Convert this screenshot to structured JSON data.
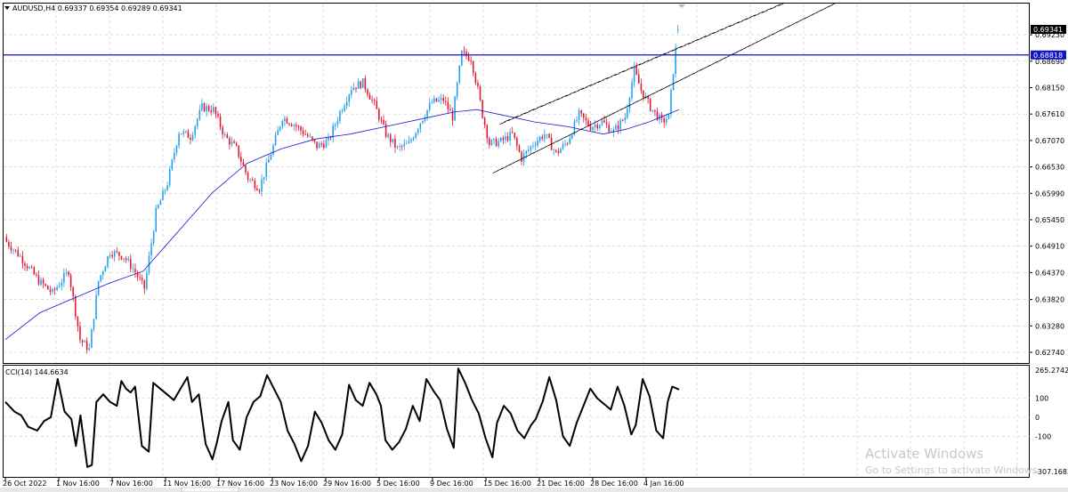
{
  "header": {
    "symbol_line": "AUDUSD,H4  0.69337 0.69354 0.69289 0.69341",
    "indicator_line": "CCI(14) 144.6634"
  },
  "colors": {
    "bull": "#1e9ff0",
    "bear": "#e8132a",
    "ma": "#1b1bd0",
    "hline": "#1212c8",
    "price_tag_bg": "#000000",
    "level_tag_bg": "#1212c8",
    "grid": "#c8c8c8",
    "cci_line": "#000000"
  },
  "watermark": {
    "title": "Activate Windows",
    "subtitle": "Go to Settings to activate Windows."
  },
  "chart_data": [
    {
      "type": "candlestick",
      "symbol": "AUDUSD",
      "timeframe": "H4",
      "last_bar": {
        "open": 0.69337,
        "high": 0.69354,
        "low": 0.69289,
        "close": 0.69341
      },
      "current_price_tag": "0.69341",
      "horizontal_level": {
        "value": 0.68818,
        "label": "0.68818"
      },
      "ylim": [
        0.6254,
        0.6985
      ],
      "yticks": [
        {
          "v": 0.6923,
          "label": "0.69230"
        },
        {
          "v": 0.6869,
          "label": "0.68690"
        },
        {
          "v": 0.6815,
          "label": "0.68150"
        },
        {
          "v": 0.6761,
          "label": "0.67610"
        },
        {
          "v": 0.6707,
          "label": "0.67070"
        },
        {
          "v": 0.6653,
          "label": "0.66530"
        },
        {
          "v": 0.6599,
          "label": "0.65990"
        },
        {
          "v": 0.6545,
          "label": "0.65450"
        },
        {
          "v": 0.6491,
          "label": "0.64910"
        },
        {
          "v": 0.6437,
          "label": "0.64370"
        },
        {
          "v": 0.6382,
          "label": "0.63820"
        },
        {
          "v": 0.6328,
          "label": "0.63280"
        },
        {
          "v": 0.6274,
          "label": "0.62740"
        }
      ],
      "xlabels": [
        "26 Oct 2022",
        "1 Nov 16:00",
        "7 Nov 16:00",
        "11 Nov 16:00",
        "17 Nov 16:00",
        "23 Nov 16:00",
        "29 Nov 16:00",
        "5 Dec 16:00",
        "9 Dec 16:00",
        "15 Dec 16:00",
        "21 Dec 16:00",
        "28 Dec 16:00",
        "4 Jan 16:00"
      ],
      "close_path": [
        [
          0,
          0.6505
        ],
        [
          7,
          0.647
        ],
        [
          15,
          0.642
        ],
        [
          21,
          0.6395
        ],
        [
          28,
          0.644
        ],
        [
          33,
          0.63
        ],
        [
          37,
          0.628
        ],
        [
          41,
          0.642
        ],
        [
          46,
          0.648
        ],
        [
          52,
          0.647
        ],
        [
          56,
          0.6445
        ],
        [
          61,
          0.6405
        ],
        [
          66,
          0.656
        ],
        [
          71,
          0.662
        ],
        [
          76,
          0.6725
        ],
        [
          81,
          0.6715
        ],
        [
          86,
          0.6775
        ],
        [
          91,
          0.677
        ],
        [
          96,
          0.6715
        ],
        [
          101,
          0.669
        ],
        [
          106,
          0.663
        ],
        [
          111,
          0.661
        ],
        [
          117,
          0.6695
        ],
        [
          121,
          0.6755
        ],
        [
          126,
          0.674
        ],
        [
          131,
          0.672
        ],
        [
          136,
          0.6695
        ],
        [
          141,
          0.6705
        ],
        [
          146,
          0.6765
        ],
        [
          151,
          0.6815
        ],
        [
          156,
          0.6825
        ],
        [
          161,
          0.678
        ],
        [
          166,
          0.672
        ],
        [
          171,
          0.669
        ],
        [
          176,
          0.67
        ],
        [
          181,
          0.6745
        ],
        [
          186,
          0.6785
        ],
        [
          191,
          0.679
        ],
        [
          195,
          0.6755
        ],
        [
          199,
          0.6885
        ],
        [
          203,
          0.6875
        ],
        [
          206,
          0.681
        ],
        [
          208,
          0.676
        ],
        [
          211,
          0.67
        ],
        [
          216,
          0.6705
        ],
        [
          221,
          0.672
        ],
        [
          225,
          0.667
        ],
        [
          230,
          0.67
        ],
        [
          235,
          0.672
        ],
        [
          240,
          0.668
        ],
        [
          245,
          0.6705
        ],
        [
          250,
          0.676
        ],
        [
          255,
          0.6735
        ],
        [
          260,
          0.6745
        ],
        [
          265,
          0.6725
        ],
        [
          270,
          0.6755
        ],
        [
          274,
          0.685
        ],
        [
          277,
          0.681
        ],
        [
          281,
          0.6775
        ],
        [
          286,
          0.6745
        ],
        [
          289,
          0.6755
        ],
        [
          291,
          0.685
        ],
        [
          293,
          0.6934
        ]
      ],
      "ma_path": [
        [
          0,
          0.63
        ],
        [
          15,
          0.6355
        ],
        [
          30,
          0.6385
        ],
        [
          45,
          0.6415
        ],
        [
          60,
          0.644
        ],
        [
          75,
          0.652
        ],
        [
          90,
          0.66
        ],
        [
          105,
          0.666
        ],
        [
          120,
          0.669
        ],
        [
          135,
          0.671
        ],
        [
          150,
          0.672
        ],
        [
          165,
          0.6735
        ],
        [
          180,
          0.675
        ],
        [
          195,
          0.6765
        ],
        [
          205,
          0.677
        ],
        [
          215,
          0.676
        ],
        [
          230,
          0.6745
        ],
        [
          245,
          0.6735
        ],
        [
          260,
          0.672
        ],
        [
          270,
          0.673
        ],
        [
          280,
          0.6745
        ],
        [
          293,
          0.677
        ]
      ],
      "channel_lines": [
        {
          "from": [
            212,
            0.664
          ],
          "to": [
            360,
            0.6985
          ]
        },
        {
          "from": [
            214,
            0.6645
          ],
          "to": [
            362,
            0.699
          ]
        },
        {
          "from": [
            215,
            0.674
          ],
          "to": [
            340,
            0.699
          ]
        },
        {
          "from": [
            217,
            0.6745
          ],
          "to": [
            342,
            0.6995
          ]
        }
      ],
      "total_bars": 293
    },
    {
      "type": "line",
      "name": "CCI(14)",
      "last_value": 144.6634,
      "ylim": [
        -307.1683,
        265.2742
      ],
      "yticks": [
        {
          "v": 265.2742,
          "label": "265.2742"
        },
        {
          "v": 100,
          "label": "100"
        },
        {
          "v": 0,
          "label": "0"
        },
        {
          "v": -100,
          "label": "-100"
        },
        {
          "v": -307.1683,
          "label": "-307.1683"
        }
      ],
      "path": [
        [
          0,
          80
        ],
        [
          4,
          30
        ],
        [
          7,
          10
        ],
        [
          10,
          -50
        ],
        [
          14,
          -70
        ],
        [
          17,
          -20
        ],
        [
          20,
          0
        ],
        [
          23,
          200
        ],
        [
          26,
          30
        ],
        [
          29,
          -10
        ],
        [
          31,
          -150
        ],
        [
          33,
          10
        ],
        [
          36,
          -260
        ],
        [
          38,
          -250
        ],
        [
          40,
          80
        ],
        [
          43,
          120
        ],
        [
          46,
          80
        ],
        [
          49,
          60
        ],
        [
          51,
          190
        ],
        [
          53,
          150
        ],
        [
          55,
          130
        ],
        [
          57,
          160
        ],
        [
          60,
          -150
        ],
        [
          63,
          -180
        ],
        [
          65,
          180
        ],
        [
          68,
          150
        ],
        [
          71,
          120
        ],
        [
          74,
          90
        ],
        [
          77,
          150
        ],
        [
          80,
          210
        ],
        [
          82,
          80
        ],
        [
          85,
          120
        ],
        [
          88,
          -140
        ],
        [
          91,
          -220
        ],
        [
          93,
          -130
        ],
        [
          95,
          -20
        ],
        [
          98,
          80
        ],
        [
          100,
          -120
        ],
        [
          103,
          -170
        ],
        [
          106,
          0
        ],
        [
          109,
          80
        ],
        [
          112,
          110
        ],
        [
          115,
          220
        ],
        [
          118,
          150
        ],
        [
          121,
          80
        ],
        [
          124,
          -70
        ],
        [
          127,
          -140
        ],
        [
          130,
          -230
        ],
        [
          133,
          -150
        ],
        [
          136,
          30
        ],
        [
          139,
          -30
        ],
        [
          142,
          -120
        ],
        [
          145,
          -170
        ],
        [
          148,
          -90
        ],
        [
          151,
          170
        ],
        [
          154,
          90
        ],
        [
          157,
          60
        ],
        [
          160,
          180
        ],
        [
          163,
          120
        ],
        [
          165,
          60
        ],
        [
          167,
          -120
        ],
        [
          170,
          -170
        ],
        [
          173,
          -130
        ],
        [
          176,
          -60
        ],
        [
          179,
          60
        ],
        [
          182,
          -20
        ],
        [
          185,
          200
        ],
        [
          188,
          140
        ],
        [
          191,
          90
        ],
        [
          194,
          -60
        ],
        [
          197,
          -160
        ],
        [
          199,
          255
        ],
        [
          202,
          180
        ],
        [
          205,
          90
        ],
        [
          208,
          20
        ],
        [
          211,
          -110
        ],
        [
          214,
          -210
        ],
        [
          216,
          -30
        ],
        [
          219,
          60
        ],
        [
          222,
          20
        ],
        [
          225,
          -70
        ],
        [
          228,
          -110
        ],
        [
          231,
          -40
        ],
        [
          233,
          -10
        ],
        [
          236,
          80
        ],
        [
          239,
          210
        ],
        [
          242,
          90
        ],
        [
          245,
          -100
        ],
        [
          248,
          -150
        ],
        [
          251,
          -30
        ],
        [
          254,
          60
        ],
        [
          257,
          150
        ],
        [
          260,
          100
        ],
        [
          263,
          70
        ],
        [
          266,
          40
        ],
        [
          269,
          160
        ],
        [
          272,
          60
        ],
        [
          275,
          -90
        ],
        [
          277,
          -40
        ],
        [
          280,
          200
        ],
        [
          283,
          110
        ],
        [
          286,
          -70
        ],
        [
          289,
          -110
        ],
        [
          291,
          80
        ],
        [
          293,
          160
        ],
        [
          296,
          145
        ]
      ],
      "total_bars": 296
    }
  ]
}
